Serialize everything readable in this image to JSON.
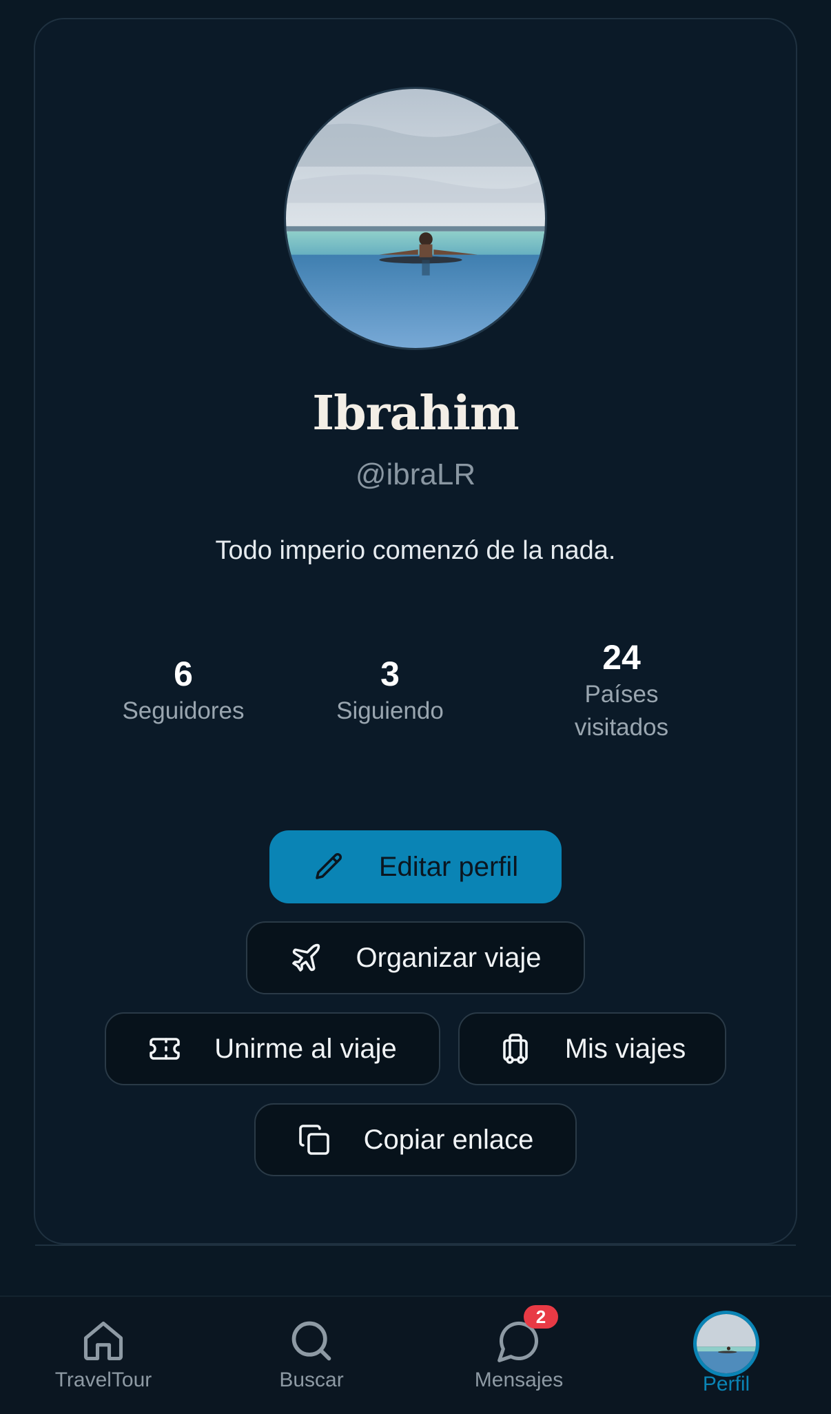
{
  "profile": {
    "name": "Ibrahim",
    "handle": "@ibraLR",
    "bio": "Todo imperio comenzó de la nada."
  },
  "stats": [
    {
      "value": "6",
      "label": "Seguidores"
    },
    {
      "value": "3",
      "label": "Siguiendo"
    },
    {
      "value": "24",
      "label_line1": "Países",
      "label_line2": "visitados"
    }
  ],
  "actions": {
    "edit_profile": "Editar perfil",
    "organize_trip": "Organizar viaje",
    "join_trip": "Unirme al viaje",
    "my_trips": "Mis viajes",
    "copy_link": "Copiar enlace"
  },
  "tabbar": {
    "home": "TravelTour",
    "search": "Buscar",
    "messages": "Mensajes",
    "messages_badge": "2",
    "profile": "Perfil"
  },
  "icons": {
    "edit": "pencil-icon",
    "organize": "airplane-icon",
    "join": "ticket-icon",
    "my_trips": "luggage-icon",
    "copy": "copy-icon",
    "home": "home-icon",
    "search": "search-icon",
    "messages": "chat-bubble-icon"
  },
  "colors": {
    "accent": "#0a84b5",
    "background": "#0a1824",
    "badge": "#e83a45"
  }
}
